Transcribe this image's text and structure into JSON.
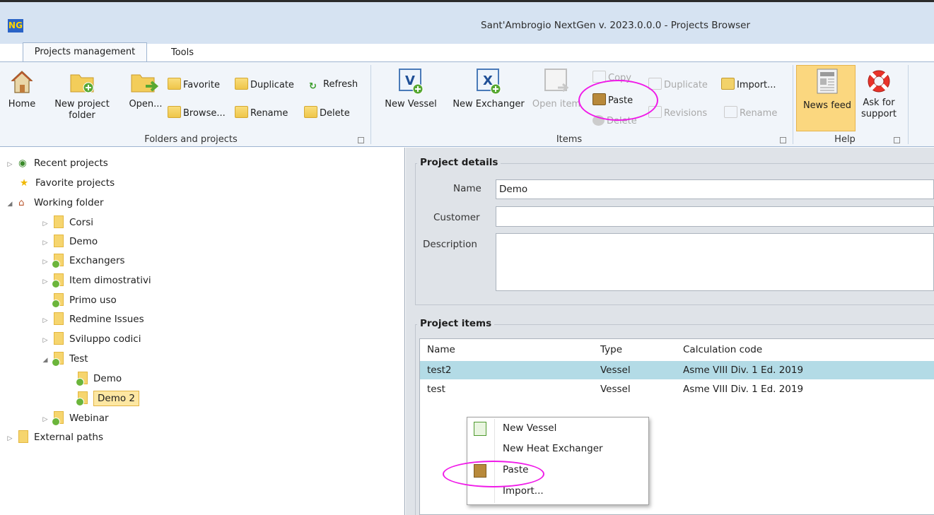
{
  "window": {
    "logo": "NG",
    "title": "Sant'Ambrogio NextGen v. 2023.0.0.0 - Projects Browser"
  },
  "tabs": {
    "projects": "Projects management",
    "tools": "Tools"
  },
  "ribbon": {
    "folders": {
      "home": "Home",
      "new_project_1": "New project",
      "new_project_2": "folder",
      "open": "Open...",
      "favorite": "Favorite",
      "duplicate": "Duplicate",
      "refresh": "Refresh",
      "browse": "Browse...",
      "rename": "Rename",
      "delete": "Delete",
      "label": "Folders and projects"
    },
    "items": {
      "new_vessel": "New Vessel",
      "new_exchanger": "New Exchanger",
      "open_item": "Open item",
      "copy": "Copy",
      "paste": "Paste",
      "delete": "Delete",
      "duplicate": "Duplicate",
      "import": "Import...",
      "revisions": "Revisions",
      "rename": "Rename",
      "label": "Items"
    },
    "help": {
      "news_feed": "News feed",
      "ask_1": "Ask for",
      "ask_2": "support",
      "label": "Help"
    }
  },
  "tree": {
    "recent": "Recent projects",
    "favorite": "Favorite projects",
    "working": "Working folder",
    "children": [
      "Corsi",
      "Demo",
      "Exchangers",
      "Item dimostrativi",
      "Primo uso",
      "Redmine Issues",
      "Sviluppo codici",
      "Test"
    ],
    "test_children": [
      "Demo",
      "Demo 2"
    ],
    "webinar": "Webinar",
    "external": "External paths"
  },
  "details": {
    "title": "Project details",
    "name_label": "Name",
    "name_value": "Demo",
    "customer_label": "Customer",
    "customer_value": "",
    "description_label": "Description",
    "description_value": ""
  },
  "items": {
    "title": "Project items",
    "columns": {
      "name": "Name",
      "type": "Type",
      "code": "Calculation code"
    },
    "rows": [
      {
        "name": "test2",
        "type": "Vessel",
        "code": "Asme VIII Div. 1 Ed. 2019"
      },
      {
        "name": "test",
        "type": "Vessel",
        "code": "Asme VIII Div. 1 Ed. 2019"
      }
    ]
  },
  "context_menu": {
    "new_vessel": "New Vessel",
    "new_heat_exchanger": "New Heat Exchanger",
    "paste": "Paste",
    "import": "Import..."
  },
  "colors": {
    "selection": "#b3dbe6",
    "highlight_ring": "#f01ae8",
    "ribbon_active": "#fbd77f"
  }
}
